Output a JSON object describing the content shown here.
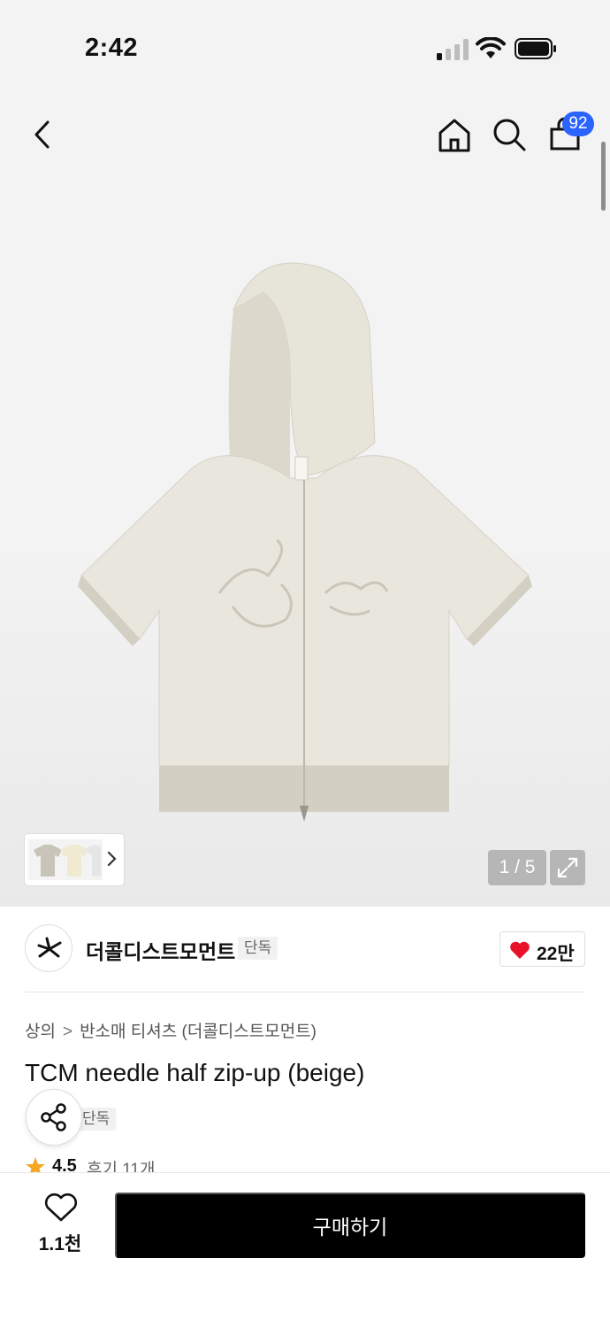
{
  "status_bar": {
    "time": "2:42"
  },
  "header": {
    "cart_count": "92"
  },
  "gallery": {
    "pager": "1 / 5"
  },
  "brand": {
    "name": "더콜디스트모먼트",
    "badge": "단독",
    "likes": "22만"
  },
  "product": {
    "breadcrumb": [
      "상의",
      "반소매 티셔츠 (더콜디스트모먼트)"
    ],
    "title": "TCM needle half zip-up (beige)",
    "badge": "단독",
    "rating": "4.5",
    "reviews": "후기 11개"
  },
  "bottom_bar": {
    "wish_count": "1.1천",
    "buy_label": "구매하기"
  },
  "colors": {
    "accent_badge": "#2b63ff",
    "heart": "#e8132b",
    "star": "#f5a623",
    "buy_button": "#000000"
  }
}
